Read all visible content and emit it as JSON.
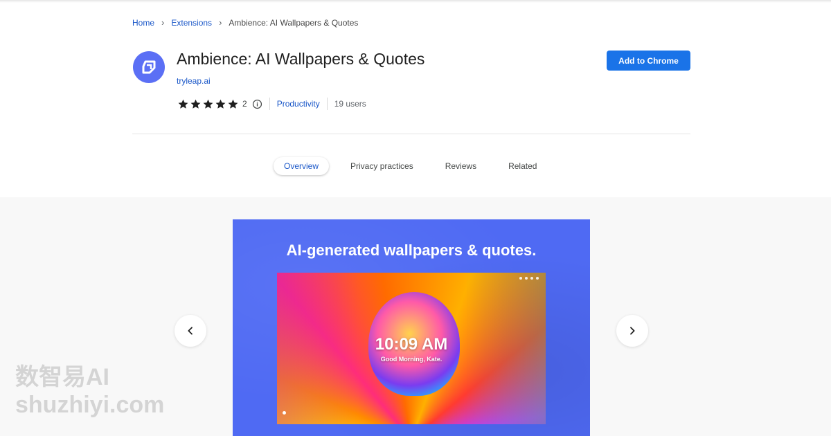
{
  "breadcrumb": {
    "home": "Home",
    "extensions": "Extensions",
    "current": "Ambience: AI Wallpapers & Quotes"
  },
  "extension": {
    "title": "Ambience: AI Wallpapers & Quotes",
    "developer": "tryleap.ai",
    "rating": 5,
    "rating_count": "2",
    "category": "Productivity",
    "users": "19 users",
    "logo_color": "#5b6ff5"
  },
  "actions": {
    "add_label": "Add to Chrome",
    "accent": "#1a73e8"
  },
  "tabs": [
    {
      "label": "Overview",
      "active": true
    },
    {
      "label": "Privacy practices",
      "active": false
    },
    {
      "label": "Reviews",
      "active": false
    },
    {
      "label": "Related",
      "active": false
    }
  ],
  "gallery": {
    "headline": "AI-generated wallpapers & quotes.",
    "time": "10:09 AM",
    "greeting": "Good Morning, Kate.",
    "prev_icon": "chevron-left-icon",
    "next_icon": "chevron-right-icon",
    "slide_bg": "#4f6af3"
  },
  "watermark": {
    "line1": "数智易AI",
    "line2": "shuzhiyi.com"
  }
}
